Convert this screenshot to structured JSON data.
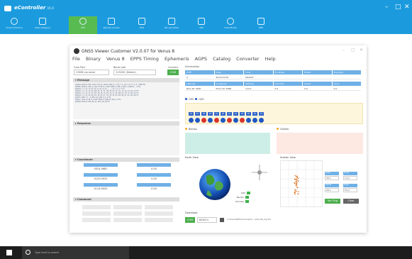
{
  "app": {
    "title": "eController",
    "version": "V1.0",
    "window_controls": [
      "–",
      "□",
      "✕"
    ],
    "toolbar": [
      {
        "label": "Smart Interface",
        "icon": "clock-icon"
      },
      {
        "label": "Data Category",
        "icon": "grid-icon"
      },
      {
        "label": "GPS",
        "icon": "gps-icon"
      },
      {
        "label": "Remote Access",
        "icon": "apps-icon"
      },
      {
        "label": "PSD",
        "icon": "chip-icon"
      },
      {
        "label": "ISC Lab Mode",
        "icon": "dashboard-icon"
      },
      {
        "label": "SIM",
        "icon": "sim-icon"
      },
      {
        "label": "Fleet Model",
        "icon": "gear-icon"
      },
      {
        "label": "PMS",
        "icon": "pms-icon"
      }
    ]
  },
  "gnss": {
    "title": "GNSS Viewer Customer V2.0.07 for Venus 8",
    "menu": [
      "File",
      "Binary",
      "Venus 8",
      "EPPS Timing",
      "Ephemeris",
      "AGPS",
      "Catalog",
      "Converter",
      "Help"
    ],
    "comport": {
      "label": "Com Port",
      "value": "COM6 via serial"
    },
    "baudrate": {
      "label": "Baud rate",
      "value": "115200 (Detect)"
    },
    "connect": {
      "label": "Connect",
      "button": "COM"
    },
    "message_title": "Message",
    "messages": [
      "$GPGGA,064223.000,2446.5718,N,12100.6089,E,1,08,1.0,110.2,M,15.1,M,,0000*6D",
      "$GPRMC,064223.000,A,2446.5718,N,12100.6089,E,000.0,000.0,060314,,,A*64",
      "$GPGSA,A,3,24,15,05,18,21,26,12,10,,,,,1.8,1.0,1.5*31",
      "$GPGSV,3,1,12,24,65,028,46,15,55,219,45,05,36,111,44,18,33,316,43*7E",
      "$GPGSV,3,2,12,21,30,153,40,26,21,043,39,12,18,198,37,10,15,262,34*71",
      "$GPGSV,3,3,12,29,09,071,28,02,07,174,25,25,05,310,00,31,02,136,00*7C",
      "$GPVTG,000.0,T,,M,000.0,N,000.0,K,A*3D",
      "$GPGLL,2446.5718,N,12100.6089,E,064223.000,A,A*5A",
      "$GPZDA,064223.000,06,03,2014,00,00*55"
    ],
    "response_title": "Response",
    "coordinate_title": "Coordinate",
    "coordinates": [
      [
        "0024.4681",
        "0.00"
      ],
      [
        "0120.0931",
        "0.00"
      ],
      [
        "0114.9925",
        "0.00"
      ]
    ],
    "command_title": "Command",
    "information_title": "Information",
    "info_headers_1": [
      "TTFF",
      "Date",
      "Time",
      "Fix Mode",
      "HDOP",
      "Elevation"
    ],
    "info_values_1": [
      "0",
      "2014-03-06",
      "064223",
      "",
      "",
      ""
    ],
    "info_headers_2": [
      "Latitude",
      "Longitude",
      "Altitude",
      "Direction",
      "Speed",
      "Clock"
    ],
    "info_values_2": [
      "N24 46' 344E",
      "E121 00' 6089",
      "110.2",
      "0.0",
      "0.0",
      "0.0"
    ],
    "gnss_tabs": [
      "GPS",
      "QZS"
    ],
    "sat_bar_colors": [
      "#ffd23a",
      "#ffd23a",
      "#ffd23a",
      "#ffd23a",
      "#ffd23a",
      "#ffd23a",
      "#ffd23a",
      "#ffd23a",
      "#ffd23a",
      "#ffd23a",
      "#ffd23a",
      "#ffd23a"
    ],
    "sat_ids": [
      "24",
      "15",
      "05",
      "18",
      "21",
      "26",
      "12",
      "10",
      "29",
      "02",
      "25",
      "31"
    ],
    "sat_circle_colors": [
      "#1f57c3",
      "#1f57c3",
      "#d8342c",
      "#1f57c3",
      "#d8342c",
      "#1f57c3",
      "#d8342c",
      "#1f57c3",
      "#d8342c",
      "#1f57c3",
      "#1f57c3",
      "#1f57c3"
    ],
    "beidou_label": "Beidou",
    "galileo_label": "Galileo",
    "earth_view_label": "Earth View",
    "scatter_label": "Scatter View",
    "legend": [
      {
        "label": "GPS",
        "color": "#3cb44b"
      },
      {
        "label": "Beidou",
        "color": "#3cb44b"
      },
      {
        "label": "Glonass",
        "color": "#3cb44b"
      }
    ],
    "scatter_controls": [
      {
        "label": "Mode",
        "value": "3D"
      },
      {
        "label": "Zoom",
        "value": "1m"
      },
      {
        "label": "Center",
        "value": "2D"
      },
      {
        "label": "Scale",
        "value": "5m"
      }
    ],
    "scatter_buttons": [
      "Set Orig",
      "Clear"
    ],
    "download_label": "Download",
    "download_button": "COM",
    "download_select": "BAUD",
    "download_path": "C:\\Users\\SE\\Downloads\\...\\venus8_log.txt",
    "colors": {
      "header_blue": "#6fb0e6",
      "accent_green": "#4cae4c",
      "beidou_dot": "#f5a623",
      "galileo_dot": "#f5a623",
      "beidou_panel": "#cdeee6",
      "galileo_panel": "#fde8e2"
    }
  },
  "taskbar": {
    "search_placeholder": "Type here to search",
    "windows_icon": "windows-icon",
    "cortana_icon": "cortana-icon"
  }
}
